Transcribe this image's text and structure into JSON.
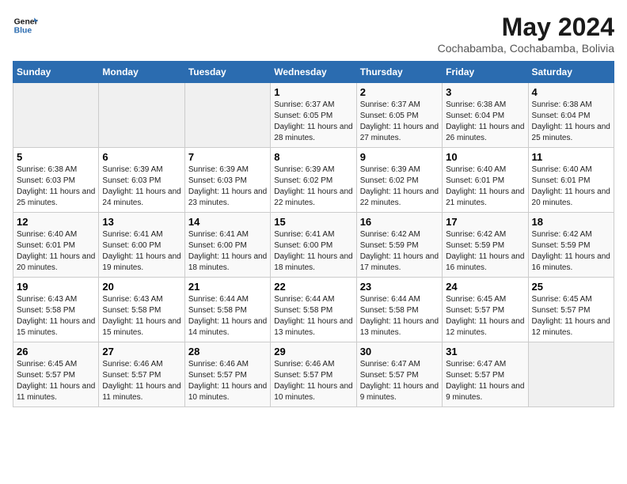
{
  "logo": {
    "text_general": "General",
    "text_blue": "Blue"
  },
  "title": "May 2024",
  "location": "Cochabamba, Cochabamba, Bolivia",
  "days_of_week": [
    "Sunday",
    "Monday",
    "Tuesday",
    "Wednesday",
    "Thursday",
    "Friday",
    "Saturday"
  ],
  "weeks": [
    [
      {
        "day": "",
        "info": ""
      },
      {
        "day": "",
        "info": ""
      },
      {
        "day": "",
        "info": ""
      },
      {
        "day": "1",
        "info": "Sunrise: 6:37 AM\nSunset: 6:05 PM\nDaylight: 11 hours and 28 minutes."
      },
      {
        "day": "2",
        "info": "Sunrise: 6:37 AM\nSunset: 6:05 PM\nDaylight: 11 hours and 27 minutes."
      },
      {
        "day": "3",
        "info": "Sunrise: 6:38 AM\nSunset: 6:04 PM\nDaylight: 11 hours and 26 minutes."
      },
      {
        "day": "4",
        "info": "Sunrise: 6:38 AM\nSunset: 6:04 PM\nDaylight: 11 hours and 25 minutes."
      }
    ],
    [
      {
        "day": "5",
        "info": "Sunrise: 6:38 AM\nSunset: 6:03 PM\nDaylight: 11 hours and 25 minutes."
      },
      {
        "day": "6",
        "info": "Sunrise: 6:39 AM\nSunset: 6:03 PM\nDaylight: 11 hours and 24 minutes."
      },
      {
        "day": "7",
        "info": "Sunrise: 6:39 AM\nSunset: 6:03 PM\nDaylight: 11 hours and 23 minutes."
      },
      {
        "day": "8",
        "info": "Sunrise: 6:39 AM\nSunset: 6:02 PM\nDaylight: 11 hours and 22 minutes."
      },
      {
        "day": "9",
        "info": "Sunrise: 6:39 AM\nSunset: 6:02 PM\nDaylight: 11 hours and 22 minutes."
      },
      {
        "day": "10",
        "info": "Sunrise: 6:40 AM\nSunset: 6:01 PM\nDaylight: 11 hours and 21 minutes."
      },
      {
        "day": "11",
        "info": "Sunrise: 6:40 AM\nSunset: 6:01 PM\nDaylight: 11 hours and 20 minutes."
      }
    ],
    [
      {
        "day": "12",
        "info": "Sunrise: 6:40 AM\nSunset: 6:01 PM\nDaylight: 11 hours and 20 minutes."
      },
      {
        "day": "13",
        "info": "Sunrise: 6:41 AM\nSunset: 6:00 PM\nDaylight: 11 hours and 19 minutes."
      },
      {
        "day": "14",
        "info": "Sunrise: 6:41 AM\nSunset: 6:00 PM\nDaylight: 11 hours and 18 minutes."
      },
      {
        "day": "15",
        "info": "Sunrise: 6:41 AM\nSunset: 6:00 PM\nDaylight: 11 hours and 18 minutes."
      },
      {
        "day": "16",
        "info": "Sunrise: 6:42 AM\nSunset: 5:59 PM\nDaylight: 11 hours and 17 minutes."
      },
      {
        "day": "17",
        "info": "Sunrise: 6:42 AM\nSunset: 5:59 PM\nDaylight: 11 hours and 16 minutes."
      },
      {
        "day": "18",
        "info": "Sunrise: 6:42 AM\nSunset: 5:59 PM\nDaylight: 11 hours and 16 minutes."
      }
    ],
    [
      {
        "day": "19",
        "info": "Sunrise: 6:43 AM\nSunset: 5:58 PM\nDaylight: 11 hours and 15 minutes."
      },
      {
        "day": "20",
        "info": "Sunrise: 6:43 AM\nSunset: 5:58 PM\nDaylight: 11 hours and 15 minutes."
      },
      {
        "day": "21",
        "info": "Sunrise: 6:44 AM\nSunset: 5:58 PM\nDaylight: 11 hours and 14 minutes."
      },
      {
        "day": "22",
        "info": "Sunrise: 6:44 AM\nSunset: 5:58 PM\nDaylight: 11 hours and 13 minutes."
      },
      {
        "day": "23",
        "info": "Sunrise: 6:44 AM\nSunset: 5:58 PM\nDaylight: 11 hours and 13 minutes."
      },
      {
        "day": "24",
        "info": "Sunrise: 6:45 AM\nSunset: 5:57 PM\nDaylight: 11 hours and 12 minutes."
      },
      {
        "day": "25",
        "info": "Sunrise: 6:45 AM\nSunset: 5:57 PM\nDaylight: 11 hours and 12 minutes."
      }
    ],
    [
      {
        "day": "26",
        "info": "Sunrise: 6:45 AM\nSunset: 5:57 PM\nDaylight: 11 hours and 11 minutes."
      },
      {
        "day": "27",
        "info": "Sunrise: 6:46 AM\nSunset: 5:57 PM\nDaylight: 11 hours and 11 minutes."
      },
      {
        "day": "28",
        "info": "Sunrise: 6:46 AM\nSunset: 5:57 PM\nDaylight: 11 hours and 10 minutes."
      },
      {
        "day": "29",
        "info": "Sunrise: 6:46 AM\nSunset: 5:57 PM\nDaylight: 11 hours and 10 minutes."
      },
      {
        "day": "30",
        "info": "Sunrise: 6:47 AM\nSunset: 5:57 PM\nDaylight: 11 hours and 9 minutes."
      },
      {
        "day": "31",
        "info": "Sunrise: 6:47 AM\nSunset: 5:57 PM\nDaylight: 11 hours and 9 minutes."
      },
      {
        "day": "",
        "info": ""
      }
    ]
  ]
}
